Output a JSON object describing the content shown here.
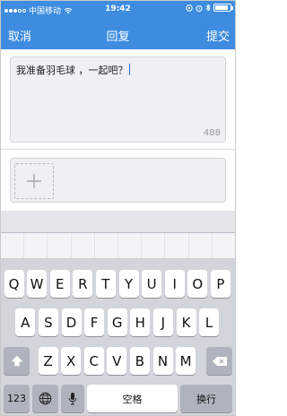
{
  "status_bar": {
    "carrier": "中国移动",
    "time": "19:42",
    "signal_bars": 3,
    "battery_level": 0.9
  },
  "nav": {
    "cancel_label": "取消",
    "title": "回复",
    "submit_label": "提交"
  },
  "compose": {
    "text": "我准备羽毛球 ，一起吧？",
    "char_counter": "488"
  },
  "photo": {
    "add_icon": "plus-icon"
  },
  "keyboard": {
    "row1": [
      "Q",
      "W",
      "E",
      "R",
      "T",
      "Y",
      "U",
      "I",
      "O",
      "P"
    ],
    "row2": [
      "A",
      "S",
      "D",
      "F",
      "G",
      "H",
      "J",
      "K",
      "L"
    ],
    "row3": [
      "Z",
      "X",
      "C",
      "V",
      "B",
      "N",
      "M"
    ],
    "numbers_label": "123",
    "space_label": "空格",
    "return_label": "换行",
    "shift_icon": "shift-icon",
    "delete_icon": "delete-icon",
    "globe_icon": "globe-icon",
    "mic_icon": "microphone-icon"
  },
  "colors": {
    "accent": "#3d8ce0",
    "key_bg": "#ffffff",
    "keyboard_bg": "#d2d5db"
  }
}
